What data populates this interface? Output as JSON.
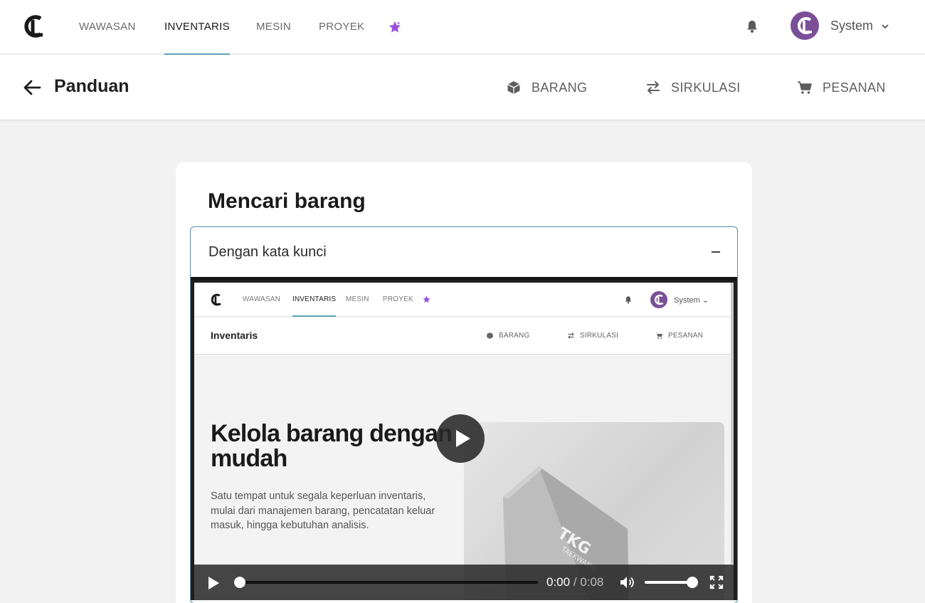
{
  "nav": {
    "links": [
      "WAWASAN",
      "INVENTARIS",
      "MESIN",
      "PROYEK"
    ],
    "active": "INVENTARIS",
    "user_name": "System",
    "accent_color": "#5aa3b8",
    "avatar_color": "#7a4f98",
    "star_icon_color": "#9b4fd6"
  },
  "subheader": {
    "title": "Panduan",
    "links": [
      {
        "label": "BARANG",
        "icon": "box-icon"
      },
      {
        "label": "SIRKULASI",
        "icon": "swap-icon"
      },
      {
        "label": "PESANAN",
        "icon": "cart-icon"
      }
    ]
  },
  "card": {
    "title": "Mencari barang",
    "accordion": {
      "label": "Dengan kata kunci",
      "expanded": true,
      "toggle_symbol": "–"
    }
  },
  "video": {
    "current_time": "0:00",
    "separator": "/",
    "duration": "0:08",
    "progress": 0,
    "volume": 1,
    "screen": {
      "nav_links": [
        "WAWASAN",
        "INVENTARIS",
        "MESIN",
        "PROYEK"
      ],
      "user_name": "System",
      "page_title": "Inventaris",
      "sub_links": [
        "BARANG",
        "SIRKULASI",
        "PESANAN"
      ],
      "hero_title": "Kelola barang dengan mudah",
      "hero_desc": "Satu tempat untuk segala keperluan inventaris, mulai dari manajemen barang, pencatatan keluar masuk, hingga kebutuhan analisis.",
      "image_text_1": "TKG",
      "image_text_2": "TAEKWANG"
    }
  }
}
